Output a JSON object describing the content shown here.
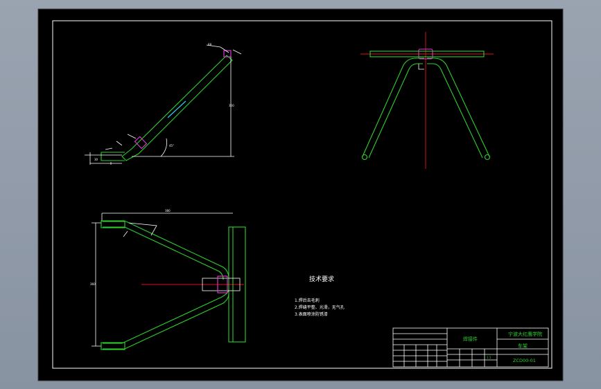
{
  "notes": {
    "title": "技术要求",
    "items": [
      "1.焊后去毛刺",
      "2.焊缝平整、光滑，无气孔",
      "3.表面喷涂防锈漆"
    ]
  },
  "title_block": {
    "part_name": "焊接件",
    "school": "宁波大红鹰学院",
    "assembly": "车架",
    "drawing_no": "ZCD00-01",
    "scale": "1:1"
  },
  "colors": {
    "background": "#000000",
    "outline": "#2dd12d",
    "centerline": "#e0101a",
    "dimension": "#ffffff",
    "weld": "#e83ad6",
    "section": "#27d3e6"
  }
}
